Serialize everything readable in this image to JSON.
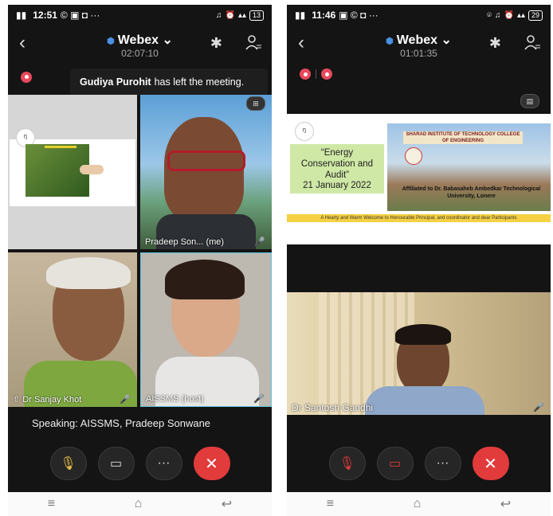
{
  "left": {
    "status_time": "12:51",
    "battery": "13",
    "app_title": "Webex",
    "meeting_timer": "02:07:10",
    "toast_name": "Gudiya Purohit",
    "toast_text": "has left the meeting.",
    "tiles": [
      {
        "name": "Pradeep Son... (me)"
      },
      {
        "name": "Dr Sanjay Khot"
      },
      {
        "name": "AISSMS (host)"
      }
    ],
    "speaking": "Speaking: AISSMS, Pradeep Sonwane"
  },
  "right": {
    "status_time": "11:46",
    "battery": "29",
    "app_title": "Webex",
    "meeting_timer": "01:01:35",
    "slide": {
      "title": "“Energy Conservation and Audit”",
      "date": "21 January 2022",
      "college": "SHARAD INSTITUTE OF TECHNOLOGY COLLEGE OF ENGINEERING",
      "affiliation": "Affiliated to Dr. Babasaheb Ambedkar Technological University, Lonere",
      "ticker": "A Hearty and Warm Welcome to Honourable Principal, and coordinator and dear Participants"
    },
    "participant_name": "Dr Santosh Gandhi"
  },
  "colors": {
    "accent_red": "#e23b3b",
    "mic_green": "#3ecf8e",
    "webex_blue": "#4a90e2"
  }
}
